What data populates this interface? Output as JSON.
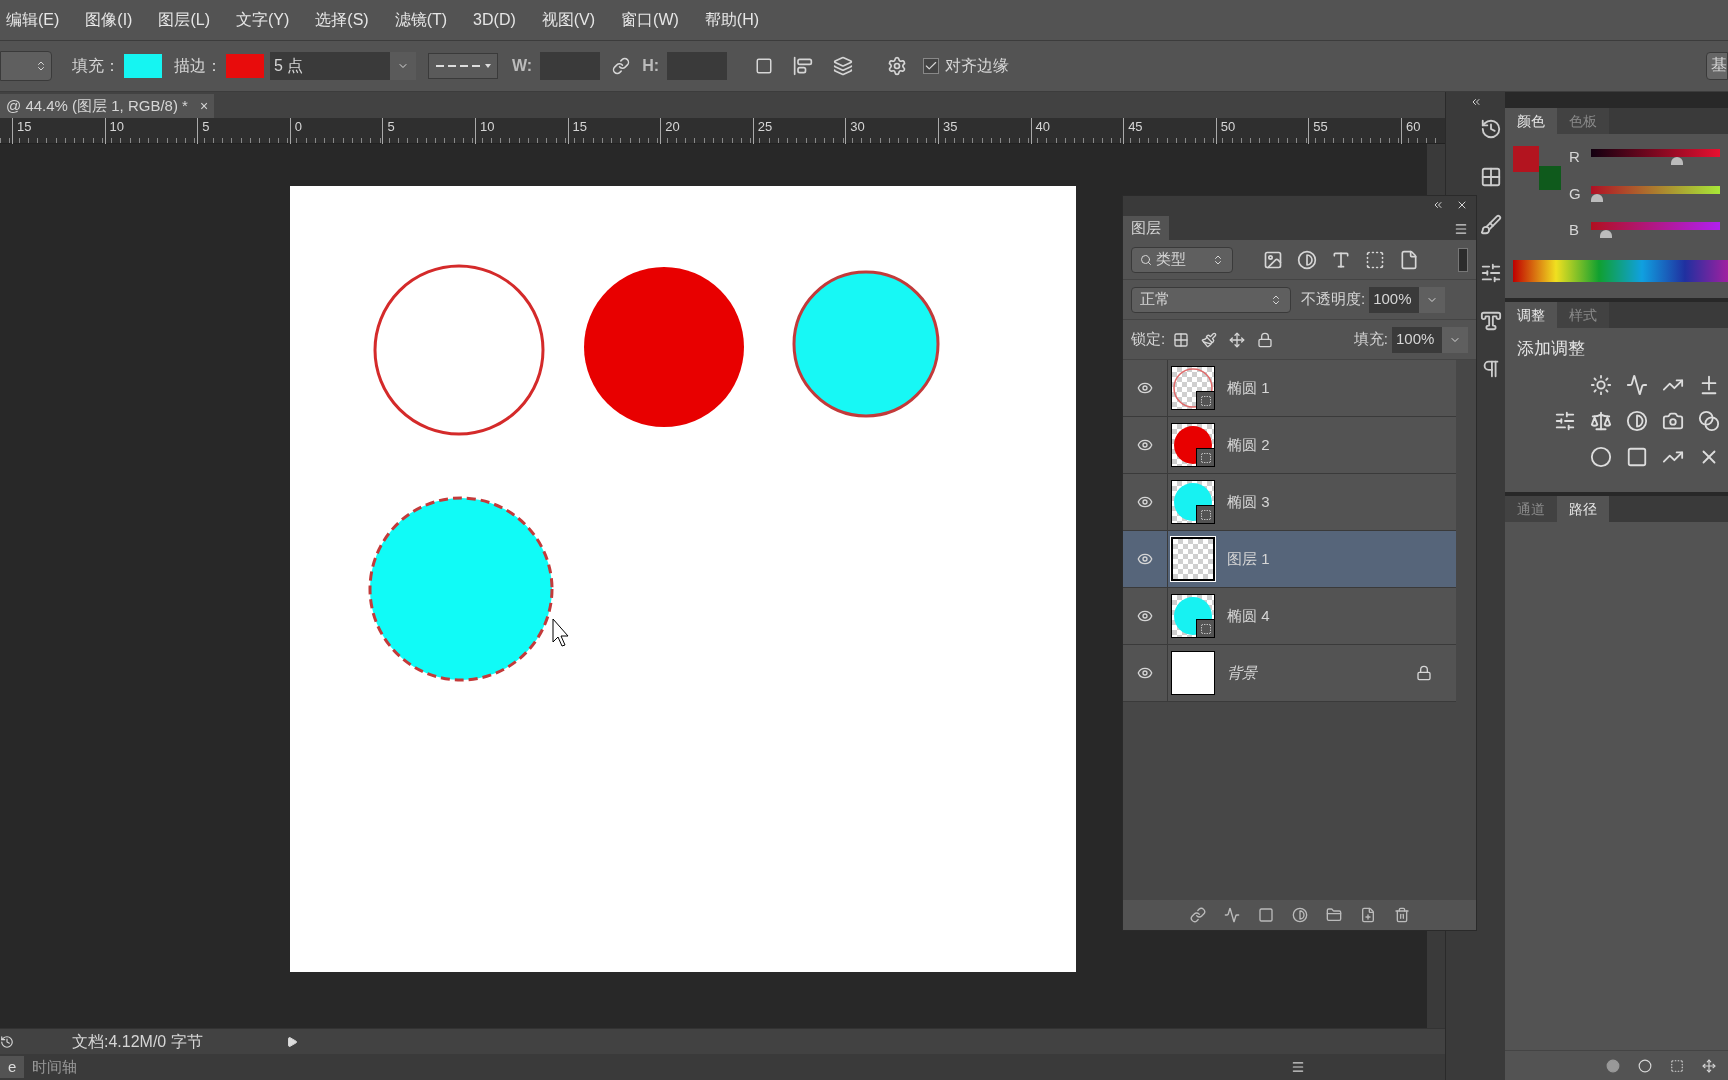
{
  "menu": [
    "编辑(E)",
    "图像(I)",
    "图层(L)",
    "文字(Y)",
    "选择(S)",
    "滤镜(T)",
    "3D(D)",
    "视图(V)",
    "窗口(W)",
    "帮助(H)"
  ],
  "options": {
    "fill": {
      "label": "填充：",
      "color": "#15f5f2"
    },
    "stroke": {
      "label": "描边：",
      "color": "#e80c0c"
    },
    "stroke_width": "5 点",
    "w_label": "W:",
    "h_label": "H:",
    "align_label": "对齐边缘",
    "align_checked": true,
    "workspace": "基"
  },
  "document_tab": {
    "title": "@ 44.4% (图层 1, RGB/8) *",
    "close": "×"
  },
  "ruler": [
    "15",
    "10",
    "5",
    "0",
    "5",
    "10",
    "15",
    "20",
    "25",
    "30",
    "35",
    "40",
    "45",
    "50",
    "55",
    "60"
  ],
  "layers_panel": {
    "tab": "图层",
    "filter": "类型",
    "blend": "正常",
    "opacity_label": "不透明度:",
    "opacity": "100%",
    "lock_label": "锁定:",
    "fill_label": "填充:",
    "fill": "100%",
    "layers": [
      {
        "name": "椭圆 1",
        "kind": "outline",
        "color": "#e06a6a",
        "selected": false,
        "visible": true,
        "locked": false
      },
      {
        "name": "椭圆 2",
        "kind": "shape",
        "color": "#e80000",
        "selected": false,
        "visible": true,
        "locked": false
      },
      {
        "name": "椭圆 3",
        "kind": "shape",
        "color": "#17f2f2",
        "selected": false,
        "visible": true,
        "locked": false
      },
      {
        "name": "图层 1",
        "kind": "pixel",
        "selected": true,
        "visible": true,
        "locked": false
      },
      {
        "name": "椭圆 4",
        "kind": "shape",
        "color": "#17f2f2",
        "selected": false,
        "visible": true,
        "locked": false
      },
      {
        "name": "背景",
        "kind": "background",
        "selected": false,
        "visible": true,
        "locked": true
      }
    ]
  },
  "color_panel": {
    "tabs": [
      {
        "label": "颜色",
        "selected": true
      },
      {
        "label": "色板",
        "selected": false
      }
    ],
    "swatches": [
      {
        "color": "#b3141f"
      },
      {
        "color": "#0f5a1c"
      }
    ],
    "sliders": [
      {
        "label": "R",
        "level": 0.67
      },
      {
        "label": "G",
        "level": 0.03
      },
      {
        "label": "B",
        "level": 0.12
      }
    ]
  },
  "adjust_panel": {
    "tabs": [
      {
        "label": "调整",
        "selected": true
      },
      {
        "label": "样式",
        "selected": false
      }
    ],
    "heading": "添加调整"
  },
  "paths_panel": {
    "tabs": [
      {
        "label": "通道",
        "selected": false
      },
      {
        "label": "路径",
        "selected": true
      }
    ]
  },
  "status_bar": {
    "text": "文档:4.12M/0 字节"
  },
  "bottom_tabs": [
    "e",
    "时间轴"
  ]
}
